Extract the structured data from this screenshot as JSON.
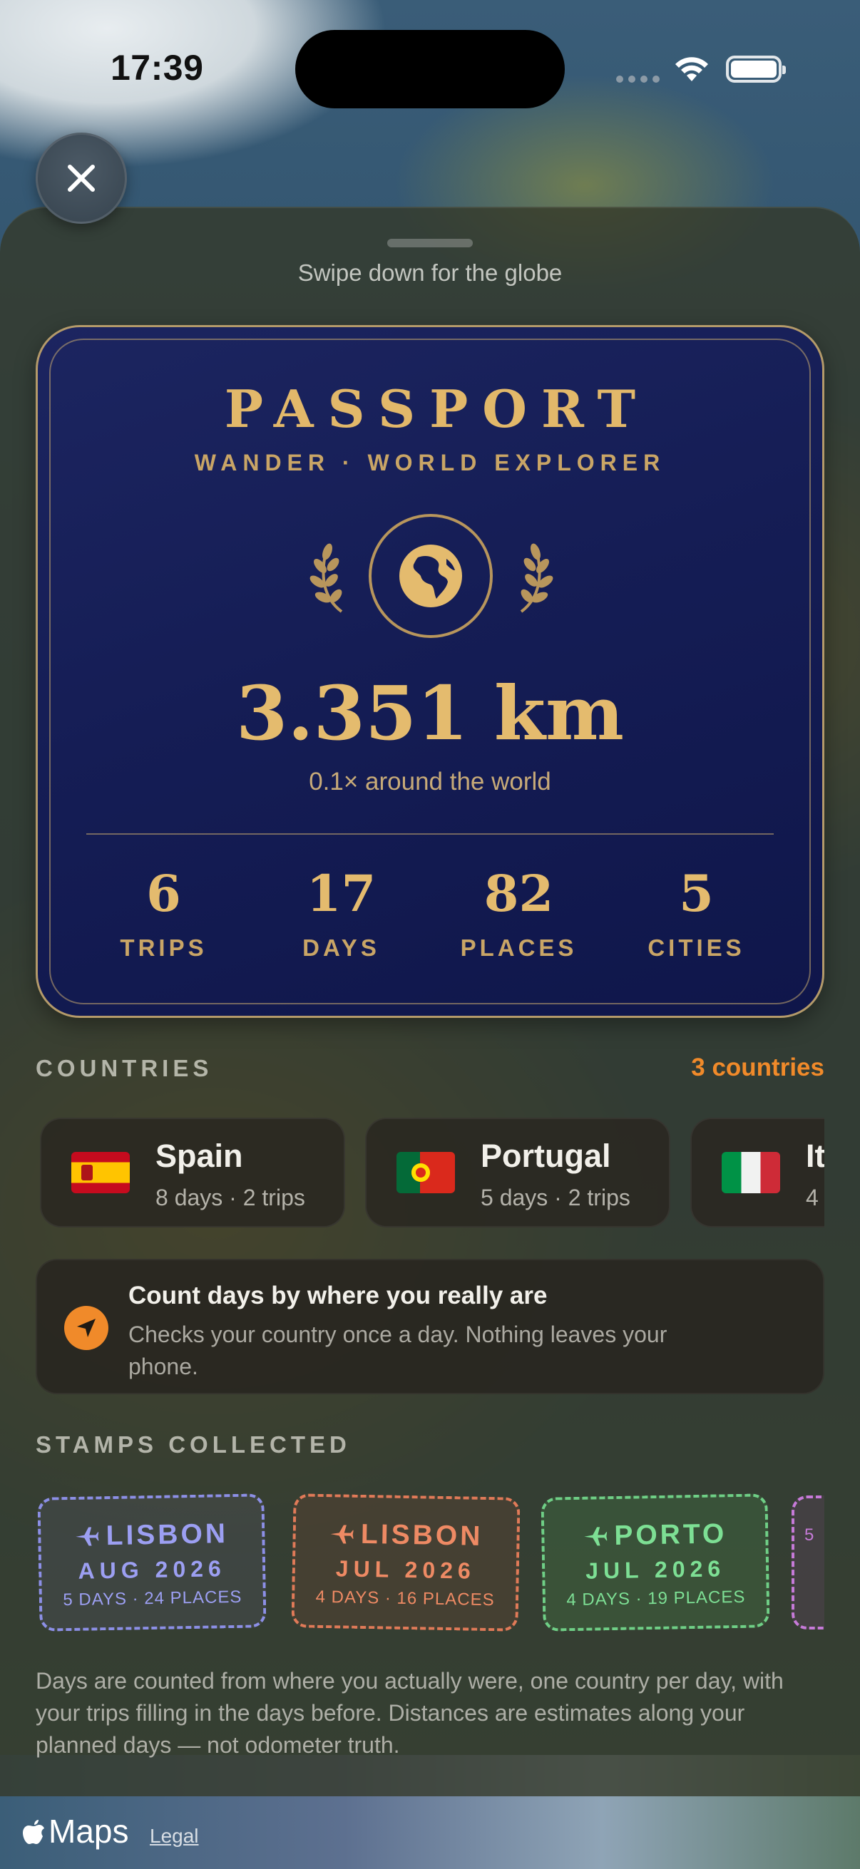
{
  "status_bar": {
    "time": "17:39"
  },
  "sheet": {
    "hint": "Swipe down for the globe"
  },
  "passport": {
    "title": "PASSPORT",
    "subtitle": "WANDER · WORLD EXPLORER",
    "emblem_icon": "globe-icon",
    "distance": "3.351 km",
    "around": "0.1× around the world",
    "stats": [
      {
        "value": "6",
        "label": "TRIPS"
      },
      {
        "value": "17",
        "label": "DAYS"
      },
      {
        "value": "82",
        "label": "PLACES"
      },
      {
        "value": "5",
        "label": "CITIES"
      }
    ]
  },
  "countries": {
    "title": "COUNTRIES",
    "count": "3 countries",
    "items": [
      {
        "name": "Spain",
        "detail": "8 days · 2 trips",
        "flag": "es"
      },
      {
        "name": "Portugal",
        "detail": "5 days · 2 trips",
        "flag": "pt"
      },
      {
        "name": "It",
        "detail": "4",
        "flag": "it"
      }
    ]
  },
  "location": {
    "title": "Count days by where you really are",
    "body": "Checks your country once a day. Nothing leaves your phone.",
    "icon": "location-arrow-icon",
    "accent": "#f08a2a"
  },
  "stamps": {
    "title": "STAMPS COLLECTED",
    "items": [
      {
        "city": "LISBON",
        "date": "AUG 2026",
        "meta": "5 DAYS · 24 PLACES",
        "color": "#9c9ff2"
      },
      {
        "city": "LISBON",
        "date": "JUL 2026",
        "meta": "4 DAYS · 16 PLACES",
        "color": "#ee8a64"
      },
      {
        "city": "PORTO",
        "date": "JUL 2026",
        "meta": "4 DAYS · 19 PLACES",
        "color": "#7ddf94"
      },
      {
        "city": "",
        "date": "",
        "meta": "5",
        "color": "#c67ad8"
      }
    ]
  },
  "footnote": "Days are counted from where you actually were, one country per day, with your trips filling in the days before. Distances are estimates along your planned days — not odometer truth.",
  "attribution": {
    "maps": "Maps",
    "legal": "Legal"
  }
}
